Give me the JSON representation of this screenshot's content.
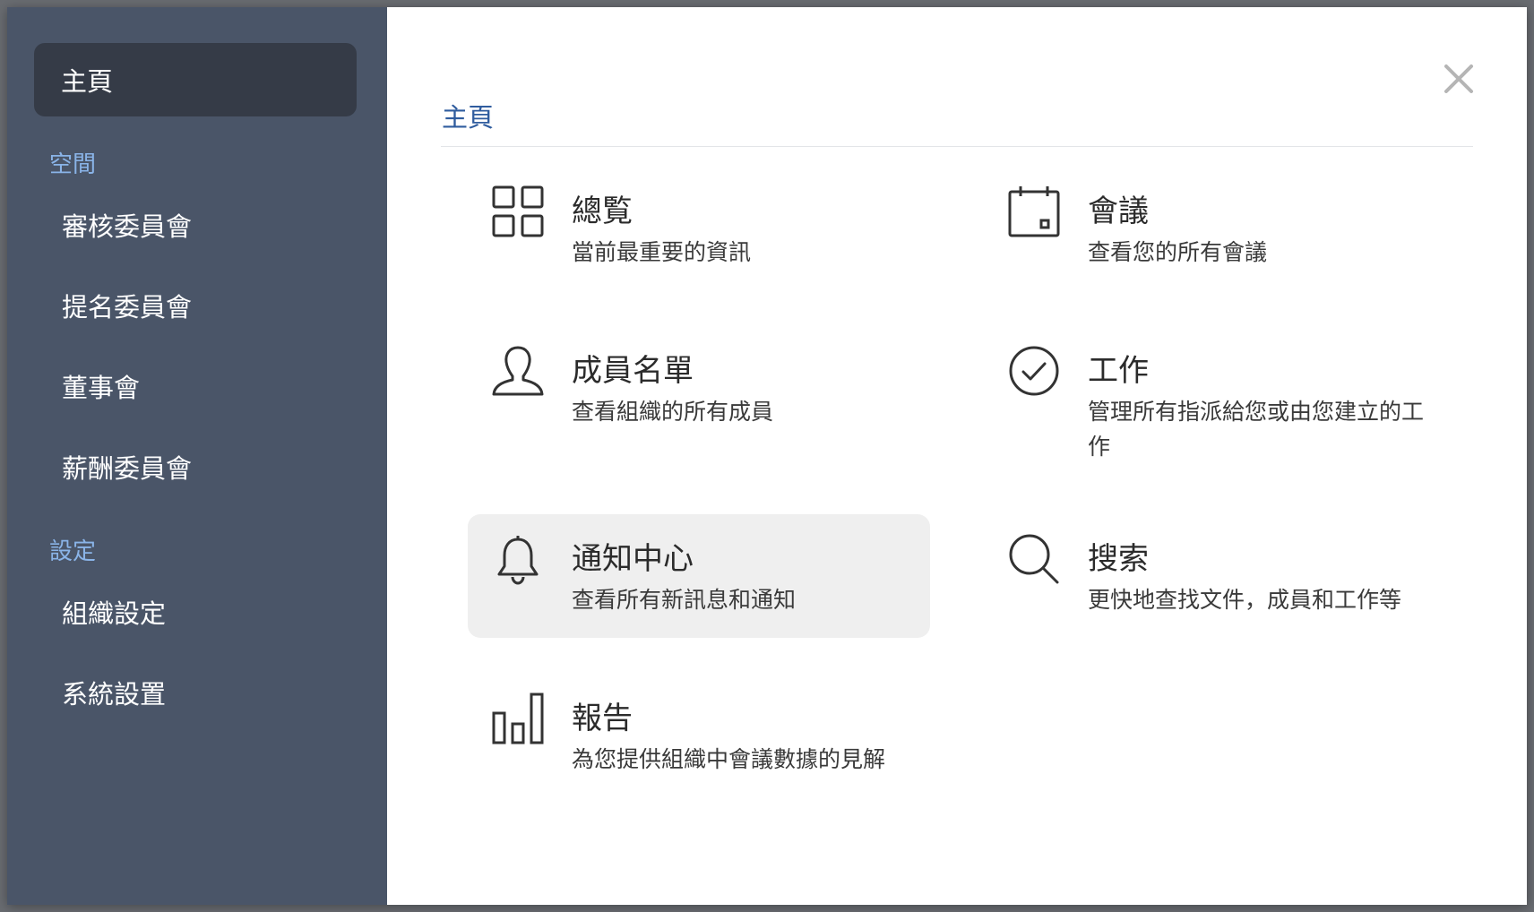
{
  "sidebar": {
    "active_item": "主頁",
    "sections": [
      {
        "label": "空間",
        "items": [
          "審核委員會",
          "提名委員會",
          "董事會",
          "薪酬委員會"
        ]
      },
      {
        "label": "設定",
        "items": [
          "組織設定",
          "系統設置"
        ]
      }
    ]
  },
  "main": {
    "title": "主頁",
    "tiles": [
      {
        "icon": "grid-icon",
        "title": "總覧",
        "desc": "當前最重要的資訊"
      },
      {
        "icon": "calendar-icon",
        "title": "會議",
        "desc": "查看您的所有會議"
      },
      {
        "icon": "person-icon",
        "title": "成員名單",
        "desc": "查看組織的所有成員"
      },
      {
        "icon": "check-circle-icon",
        "title": "工作",
        "desc": "管理所有指派給您或由您建立的工作"
      },
      {
        "icon": "bell-icon",
        "title": "通知中心",
        "desc": "查看所有新訊息和通知"
      },
      {
        "icon": "search-icon",
        "title": "搜索",
        "desc": "更快地查找文件，成員和工作等"
      },
      {
        "icon": "bar-chart-icon",
        "title": "報告",
        "desc": "為您提供組織中會議數據的見解"
      }
    ]
  },
  "colors": {
    "sidebar_bg": "#4a5568",
    "sidebar_active_bg": "#353b47",
    "section_label": "#8ab4e8",
    "title_accent": "#2f5c9e",
    "tile_highlight": "#efefef"
  }
}
